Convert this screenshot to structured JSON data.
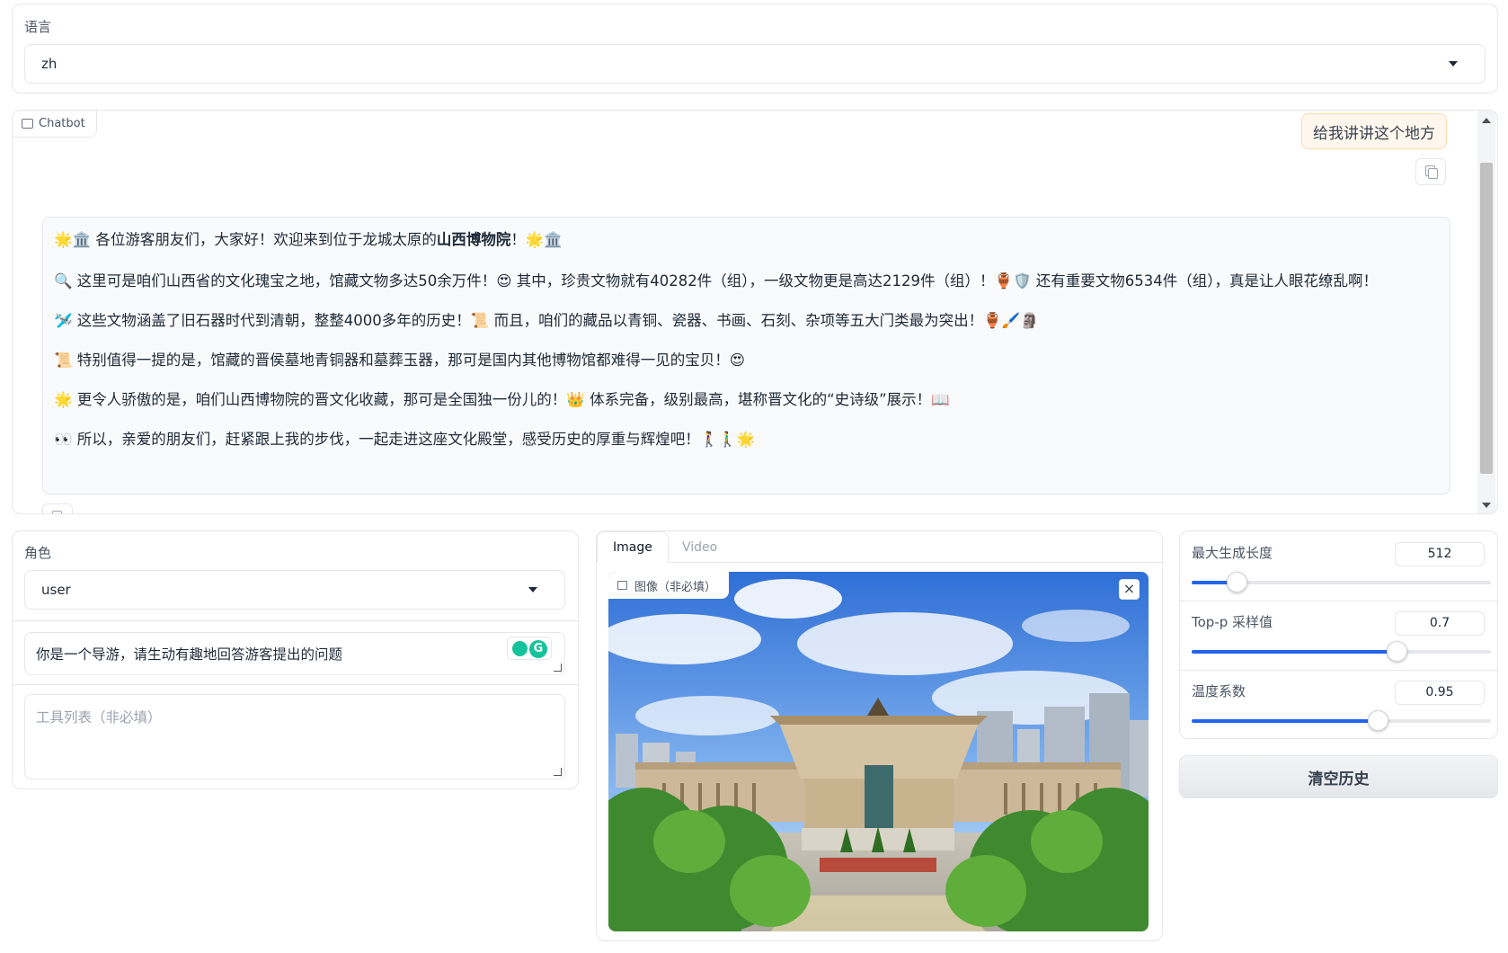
{
  "language": {
    "label": "语言",
    "value": "zh"
  },
  "chatbot": {
    "tag": "Chatbot",
    "user_message": "给我讲讲这个地方",
    "bot_message": {
      "p1_start": "🌟🏛️ 各位游客朋友们，大家好！欢迎来到位于龙城太原的",
      "p1_bold": "山西博物院",
      "p1_end": "！🌟🏛️",
      "p2": "🔍 这里可是咱们山西省的文化瑰宝之地，馆藏文物多达50余万件！😍 其中，珍贵文物就有40282件（组），一级文物更是高达2129件（组）！🏺🛡️ 还有重要文物6534件（组），真是让人眼花缭乱啊！",
      "p3": "🛩️ 这些文物涵盖了旧石器时代到清朝，整整4000多年的历史！📜 而且，咱们的藏品以青铜、瓷器、书画、石刻、杂项等五大门类最为突出！🏺🖌️🗿",
      "p4": "📜 特别值得一提的是，馆藏的晋侯墓地青铜器和墓葬玉器，那可是国内其他博物馆都难得一见的宝贝！😍",
      "p5": "🌟 更令人骄傲的是，咱们山西博物院的晋文化收藏，那可是全国独一份儿的！👑 体系完备，级别最高，堪称晋文化的“史诗级”展示！📖",
      "p6": "👀 所以，亲爱的朋友们，赶紧跟上我的步伐，一起走进这座文化殿堂，感受历史的厚重与辉煌吧！🚶‍♀️🚶‍♂️🌟"
    }
  },
  "role": {
    "label": "角色",
    "value": "user"
  },
  "system_prompt": {
    "value": "你是一个导游，请生动有趣地回答游客提出的问题"
  },
  "tools": {
    "placeholder": "工具列表（非必填）"
  },
  "media": {
    "tabs": [
      "Image",
      "Video"
    ],
    "image_label": "图像（非必填）",
    "close_icon": "×"
  },
  "params": {
    "max_length": {
      "label": "最大生成长度",
      "value": "512",
      "fraction": 0.15
    },
    "top_p": {
      "label": "Top-p 采样值",
      "value": "0.7",
      "fraction": 0.685
    },
    "temperature": {
      "label": "温度系数",
      "value": "0.95",
      "fraction": 0.622
    }
  },
  "clear_button": "清空历史",
  "colors": {
    "accent": "#2563eb",
    "user_bubble": "#fff7ed",
    "user_bubble_border": "#fcd9ae"
  }
}
